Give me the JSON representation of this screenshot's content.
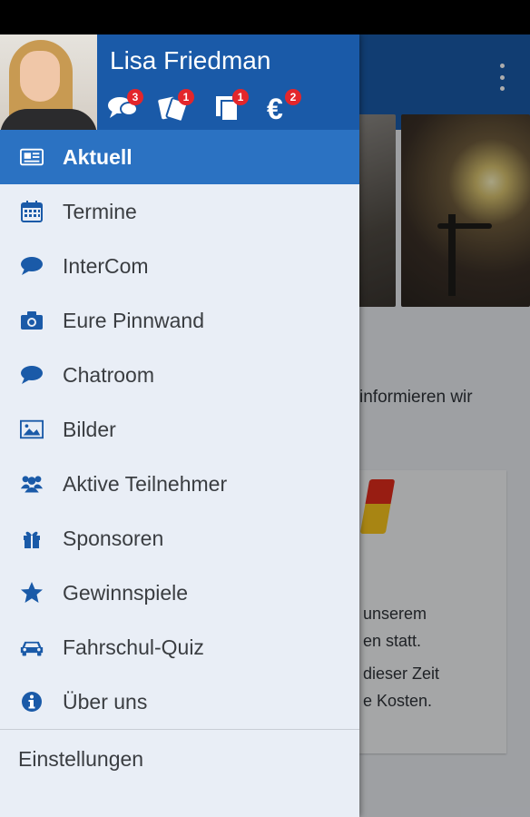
{
  "user": {
    "name": "Lisa Friedman",
    "badges": [
      {
        "icon": "chat-bubbles-icon",
        "count": "3"
      },
      {
        "icon": "tickets-icon",
        "count": "1"
      },
      {
        "icon": "documents-icon",
        "count": "1"
      },
      {
        "icon": "euro-icon",
        "count": "2"
      }
    ]
  },
  "menu": [
    {
      "label": "Aktuell",
      "icon": "newspaper-icon",
      "active": true
    },
    {
      "label": "Termine",
      "icon": "calendar-icon"
    },
    {
      "label": "InterCom",
      "icon": "chat-bubble-icon"
    },
    {
      "label": "Eure Pinnwand",
      "icon": "camera-icon"
    },
    {
      "label": "Chatroom",
      "icon": "chat-bubble-icon"
    },
    {
      "label": "Bilder",
      "icon": "picture-icon"
    },
    {
      "label": "Aktive Teilnehmer",
      "icon": "users-icon"
    },
    {
      "label": "Sponsoren",
      "icon": "gift-icon"
    },
    {
      "label": "Gewinnspiele",
      "icon": "star-icon"
    },
    {
      "label": "Fahrschul-Quiz",
      "icon": "car-icon"
    },
    {
      "label": "Über uns",
      "icon": "info-icon"
    }
  ],
  "settings_label": "Einstellungen",
  "background": {
    "text_line": "informieren wir",
    "card_lines": [
      "unserem",
      "en statt.",
      "dieser Zeit",
      "e Kosten."
    ]
  },
  "colors": {
    "brand_blue": "#1a5aa8",
    "active_blue": "#2b72c2",
    "badge_red": "#e3262b"
  }
}
